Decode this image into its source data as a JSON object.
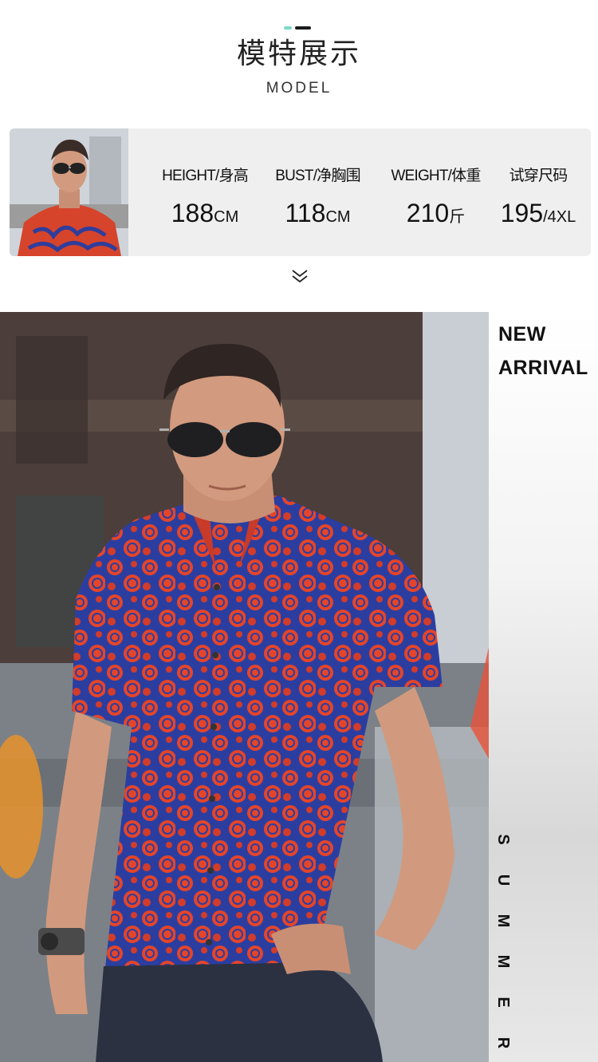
{
  "header": {
    "title": "模特展示",
    "subtitle": "MODEL"
  },
  "stats": [
    {
      "label": "HEIGHT/身高",
      "value": "188",
      "unit": "CM"
    },
    {
      "label": "BUST/净胸围",
      "value": "118",
      "unit": "CM"
    },
    {
      "label": "WEIGHT/体重",
      "value": "210",
      "unit": "斤"
    },
    {
      "label": "试穿尺码",
      "value": "195",
      "unit": "/4XL"
    }
  ],
  "side_panel": {
    "new_arrival_line1": "NEW",
    "new_arrival_line2": "ARRIVAL",
    "summer_letters": [
      "S",
      "U",
      "M",
      "M",
      "E",
      "R"
    ]
  },
  "colors": {
    "accent_teal": "#7ed9c8",
    "panel_bg": "#efefef",
    "shirt_red": "#e4452a",
    "shirt_blue": "#2b3ea0"
  },
  "icons": {
    "chevron": "double-chevron-down-icon"
  }
}
